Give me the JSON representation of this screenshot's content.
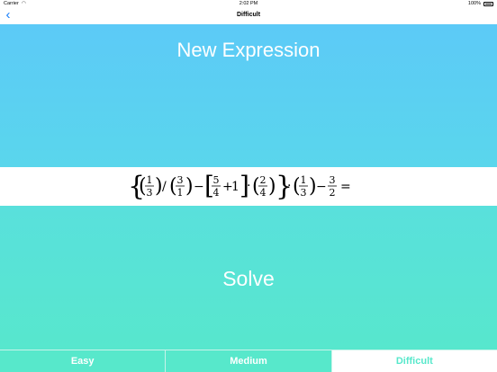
{
  "status_bar": {
    "carrier": "Carrier",
    "time": "2:02 PM",
    "battery": "100%",
    "icons": [
      "wifi-icon",
      "battery-icon"
    ]
  },
  "nav": {
    "title": "Difficult",
    "back_icon": "chevron-left-icon"
  },
  "main": {
    "new_expression_label": "New Expression",
    "solve_label": "Solve",
    "expression": {
      "terms": [
        {
          "numerator": "1",
          "denominator": "3"
        },
        {
          "operator": "/"
        },
        {
          "numerator": "3",
          "denominator": "1"
        },
        {
          "operator": "−"
        },
        {
          "numerator": "5",
          "denominator": "4"
        },
        {
          "operator": "+"
        },
        {
          "number": "1"
        },
        {
          "operator": "·"
        },
        {
          "numerator": "2",
          "denominator": "4"
        },
        {
          "operator": "·"
        },
        {
          "numerator": "1",
          "denominator": "3"
        },
        {
          "operator": "−"
        },
        {
          "numerator": "3",
          "denominator": "2"
        },
        {
          "operator": "="
        }
      ]
    }
  },
  "difficulty": {
    "options": [
      "Easy",
      "Medium",
      "Difficult"
    ],
    "selected": "Difficult"
  },
  "colors": {
    "top_gradient_start": "#5ccaf7",
    "bottom_gradient_end": "#57e7cd",
    "accent": "#57e8cb",
    "back_arrow": "#147efb"
  }
}
